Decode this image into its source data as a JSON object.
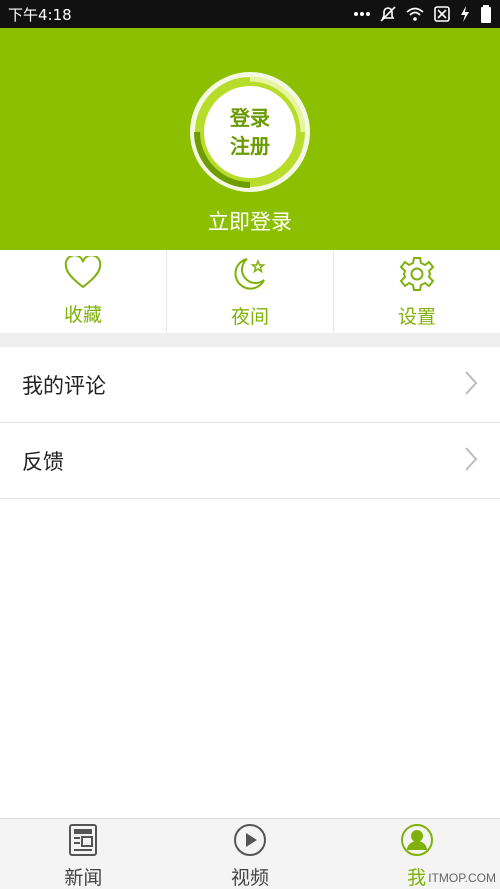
{
  "status_bar": {
    "time": "下午4:18"
  },
  "header": {
    "avatar_line1": "登录",
    "avatar_line2": "注册",
    "login_text": "立即登录",
    "bg_color": "#8bbf00"
  },
  "quick_actions": [
    {
      "label": "收藏",
      "icon": "heart-icon"
    },
    {
      "label": "夜间",
      "icon": "moon-star-icon"
    },
    {
      "label": "设置",
      "icon": "gear-icon"
    }
  ],
  "menu": [
    {
      "label": "我的评论"
    },
    {
      "label": "反馈"
    }
  ],
  "tabs": [
    {
      "label": "新闻",
      "icon": "news-icon",
      "active": false
    },
    {
      "label": "视频",
      "icon": "play-icon",
      "active": false
    },
    {
      "label": "我",
      "icon": "user-icon",
      "active": true
    }
  ],
  "watermark": "ITMOP.COM",
  "colors": {
    "accent": "#7fb10a",
    "header": "#8bbf00"
  }
}
